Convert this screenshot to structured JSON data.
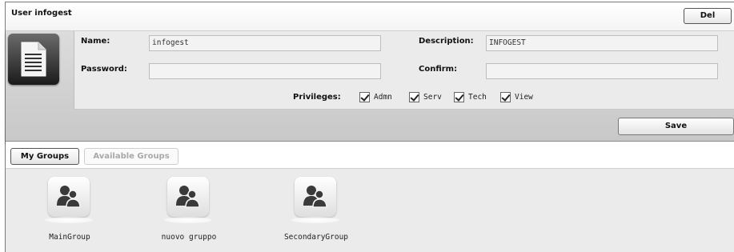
{
  "header": {
    "title": "User infogest",
    "delete_label": "Del"
  },
  "user_form": {
    "name_label": "Name:",
    "name_value": "infogest",
    "description_label": "Description:",
    "description_value": "INFOGEST",
    "password_label": "Password:",
    "password_value": "",
    "confirm_label": "Confirm:",
    "confirm_value": "",
    "privileges_label": "Privileges:",
    "privileges": [
      {
        "label": "Admn",
        "checked": true
      },
      {
        "label": "Serv",
        "checked": true
      },
      {
        "label": "Tech",
        "checked": true
      },
      {
        "label": "View",
        "checked": true
      }
    ],
    "save_label": "Save",
    "avatar_icon": "document-icon"
  },
  "tabs": [
    {
      "label": "My Groups",
      "active": true
    },
    {
      "label": "Available Groups",
      "active": false
    }
  ],
  "groups": [
    {
      "name": "MainGroup",
      "icon": "user-group-icon"
    },
    {
      "name": "nuovo gruppo",
      "icon": "user-group-icon"
    },
    {
      "name": "SecondaryGroup",
      "icon": "user-group-icon"
    }
  ]
}
